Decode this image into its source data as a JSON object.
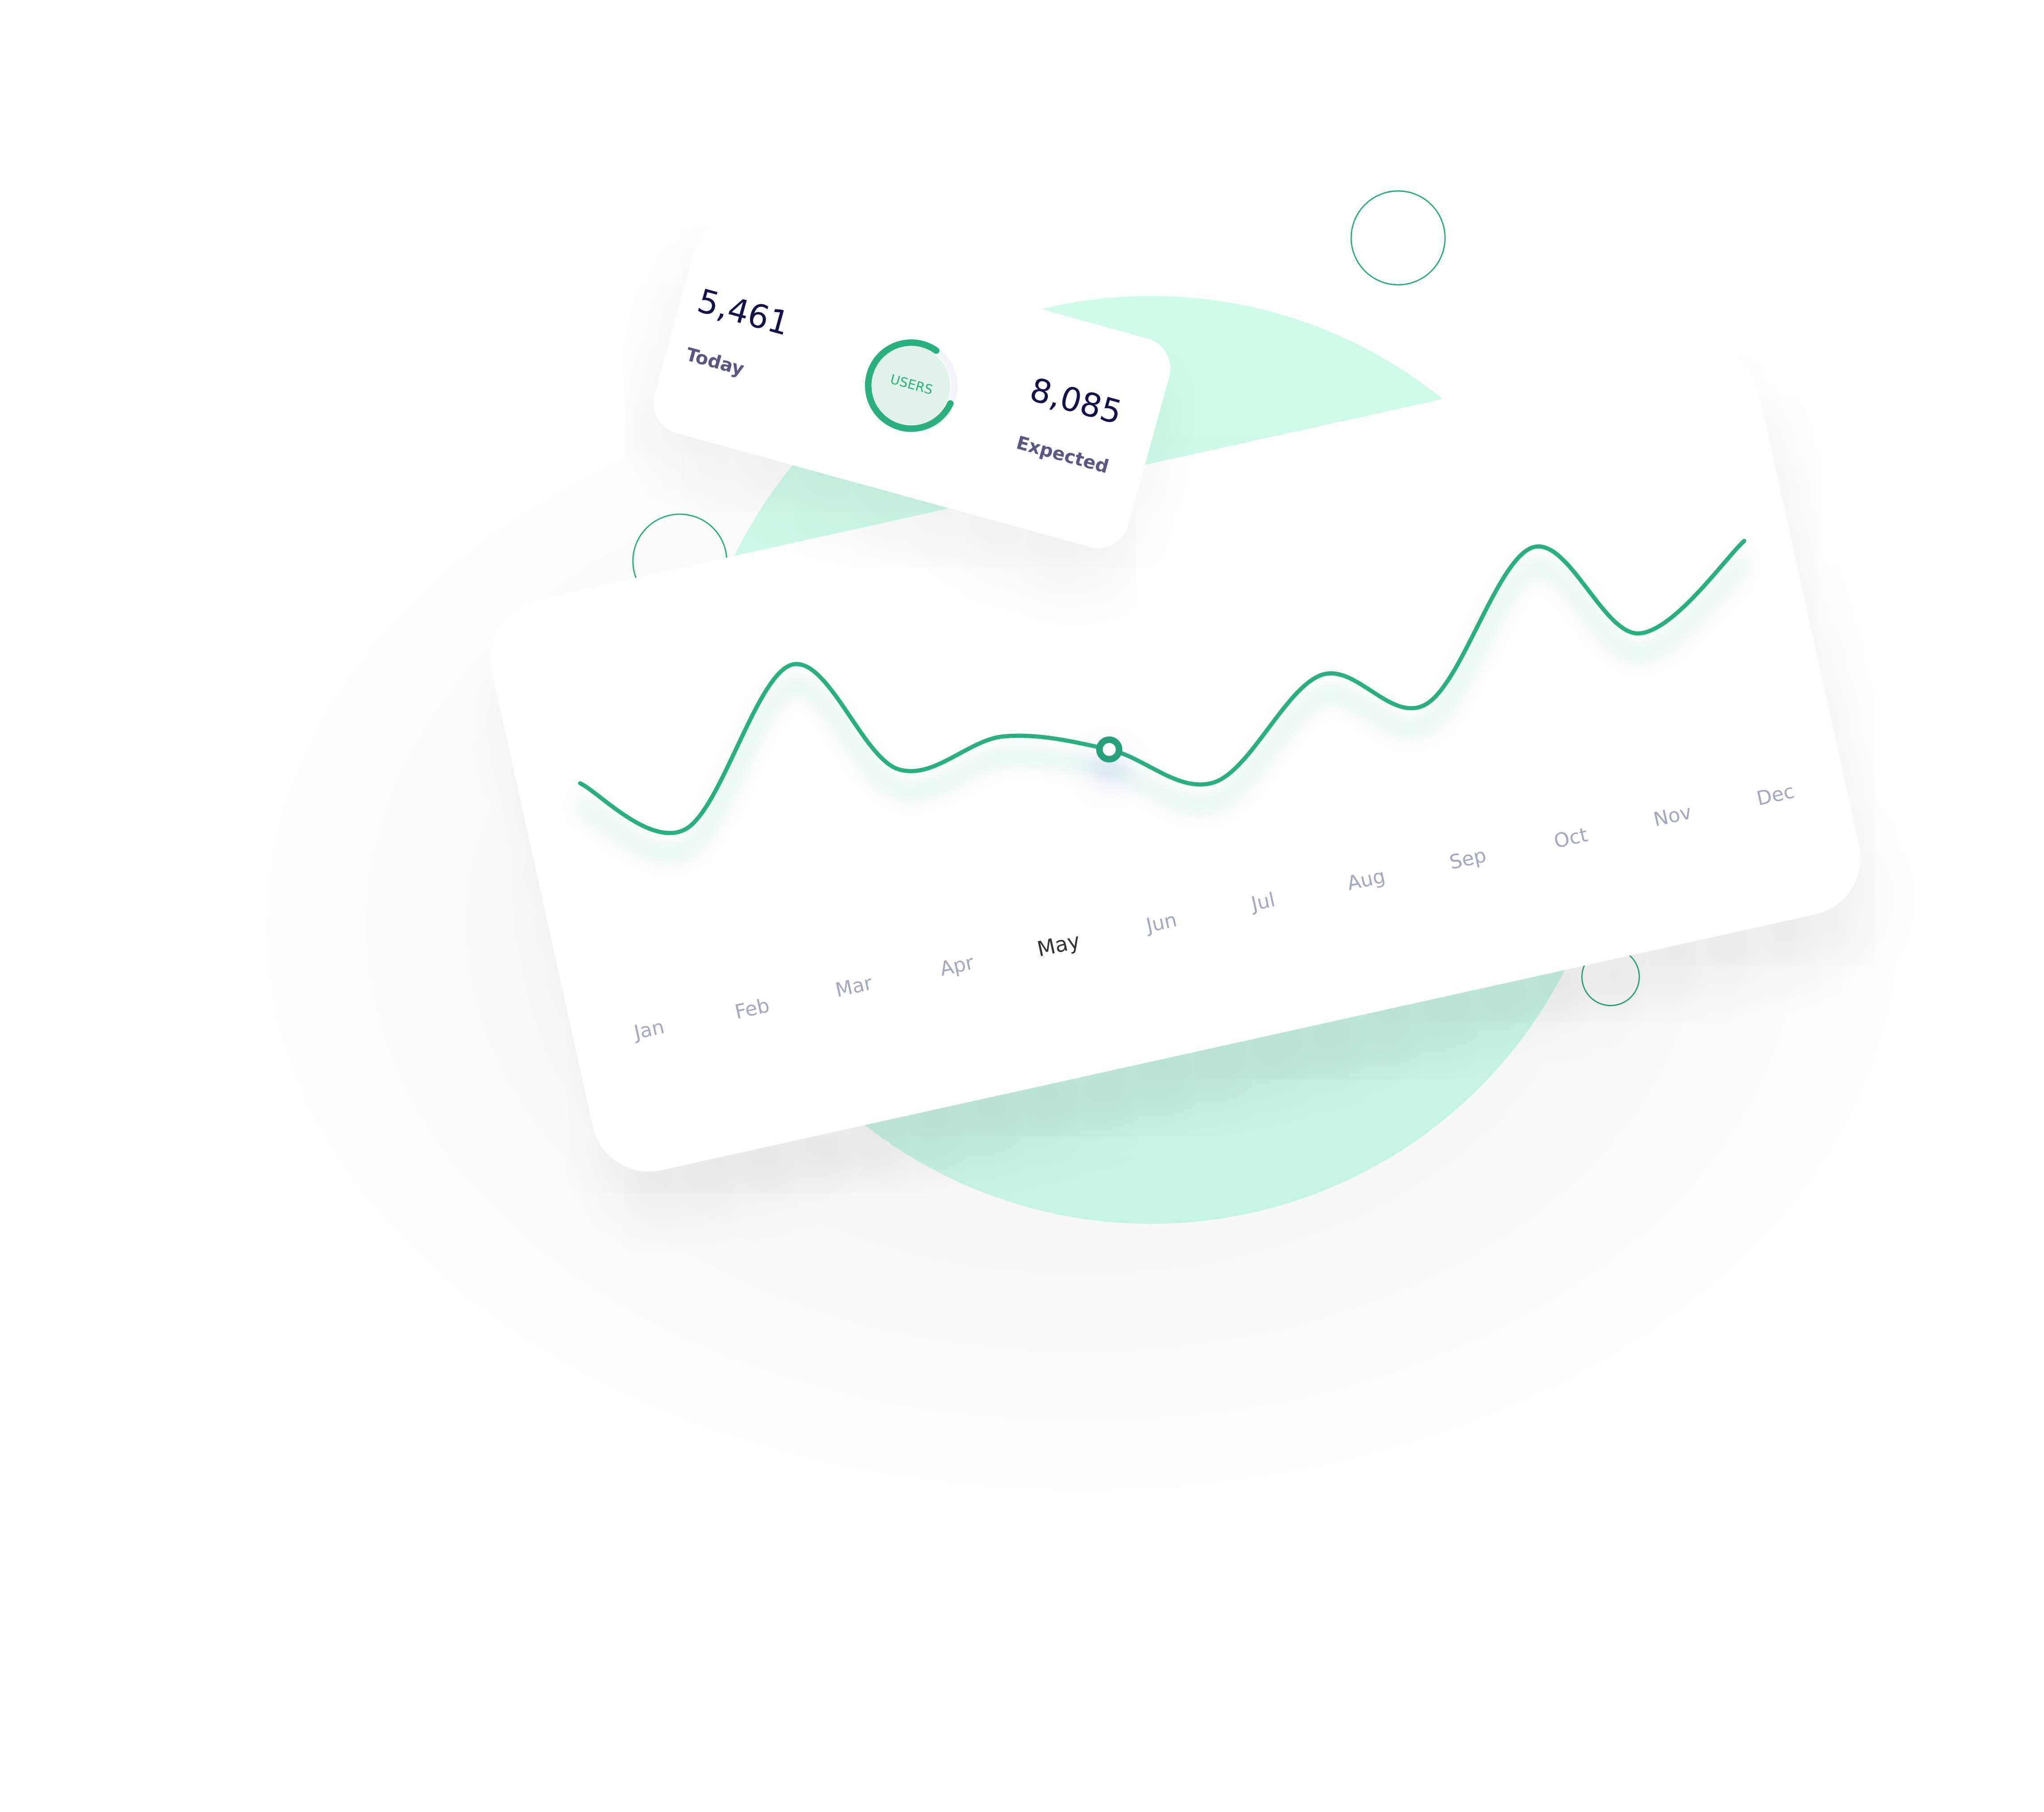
{
  "colors": {
    "accent": "#2aaf7f",
    "mint": "#c8f5e3",
    "label": "#a3a8bd",
    "active_label": "#333333",
    "number": "#14124a"
  },
  "stats_card": {
    "today": {
      "value": "5,461",
      "label": "Today"
    },
    "expected": {
      "value": "8,085",
      "label": "Expected"
    },
    "ring": {
      "label": "USERS",
      "progress": 0.78
    }
  },
  "chart_data": {
    "type": "line",
    "categories": [
      "Jan",
      "Feb",
      "Mar",
      "Apr",
      "May",
      "Jun",
      "Jul",
      "Aug",
      "Sep",
      "Oct",
      "Nov",
      "Dec"
    ],
    "values": [
      99,
      64,
      190,
      110,
      135,
      125,
      100,
      182,
      160,
      280,
      214,
      285
    ],
    "ylim": [
      0,
      300
    ],
    "active_category": "May",
    "highlighted_point": "Jun",
    "grid": false,
    "title": "",
    "xlabel": "",
    "ylabel": ""
  }
}
